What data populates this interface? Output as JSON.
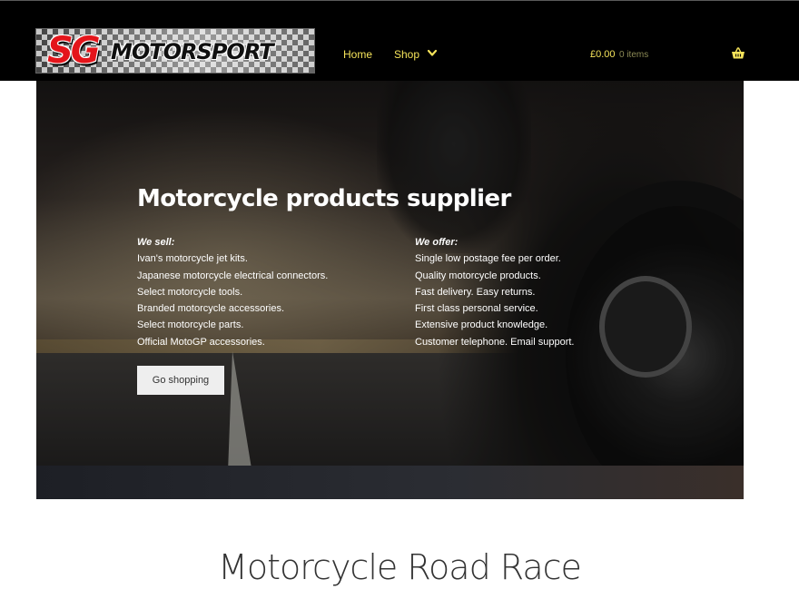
{
  "header": {
    "logo_sg": "SG",
    "logo_motorsport": "MOTORSPORT",
    "nav": {
      "home": "Home",
      "shop": "Shop"
    },
    "cart": {
      "total": "£0.00",
      "count": "0 items"
    }
  },
  "hero": {
    "title": "Motorcycle products supplier",
    "sell": {
      "heading": "We sell:",
      "items": [
        "Ivan's motorcycle jet kits.",
        "Japanese motorcycle electrical connectors.",
        "Select motorcycle tools.",
        "Branded motorcycle accessories.",
        "Select motorcycle parts.",
        "Official MotoGP accessories."
      ]
    },
    "offer": {
      "heading": "We offer:",
      "items": [
        "Single low postage fee per order.",
        "Quality motorcycle products.",
        "Fast delivery. Easy returns.",
        "First class personal service.",
        "Extensive product knowledge.",
        "Customer telephone. Email support."
      ]
    },
    "button": "Go shopping"
  },
  "section": {
    "title": "Motorcycle Road Race"
  },
  "colors": {
    "nav_text": "#f5e35a",
    "header_bg": "#000000",
    "logo_red": "#e4151b"
  },
  "icons": [
    "chevron-down-icon",
    "basket-icon"
  ]
}
